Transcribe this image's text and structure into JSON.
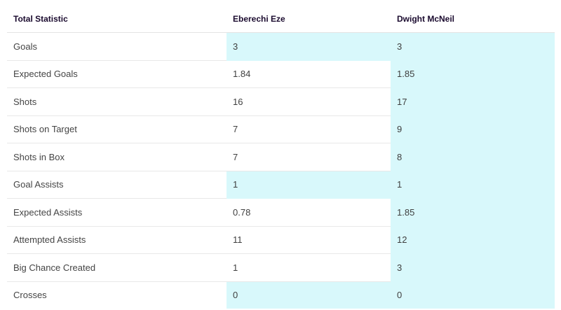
{
  "header": {
    "label": "Total Statistic",
    "player1": "Eberechi Eze",
    "player2": "Dwight McNeil"
  },
  "highlight_color": "#d8f8fb",
  "rows": [
    {
      "label": "Goals",
      "p1": "3",
      "p2": "3",
      "p1_highlight": true,
      "p2_highlight": true
    },
    {
      "label": "Expected Goals",
      "p1": "1.84",
      "p2": "1.85",
      "p1_highlight": false,
      "p2_highlight": true
    },
    {
      "label": "Shots",
      "p1": "16",
      "p2": "17",
      "p1_highlight": false,
      "p2_highlight": true
    },
    {
      "label": "Shots on Target",
      "p1": "7",
      "p2": "9",
      "p1_highlight": false,
      "p2_highlight": true
    },
    {
      "label": "Shots in Box",
      "p1": "7",
      "p2": "8",
      "p1_highlight": false,
      "p2_highlight": true
    },
    {
      "label": "Goal Assists",
      "p1": "1",
      "p2": "1",
      "p1_highlight": true,
      "p2_highlight": true
    },
    {
      "label": "Expected Assists",
      "p1": "0.78",
      "p2": "1.85",
      "p1_highlight": false,
      "p2_highlight": true
    },
    {
      "label": "Attempted Assists",
      "p1": "11",
      "p2": "12",
      "p1_highlight": false,
      "p2_highlight": true
    },
    {
      "label": "Big Chance Created",
      "p1": "1",
      "p2": "3",
      "p1_highlight": false,
      "p2_highlight": true
    },
    {
      "label": "Crosses",
      "p1": "0",
      "p2": "0",
      "p1_highlight": true,
      "p2_highlight": true
    }
  ]
}
